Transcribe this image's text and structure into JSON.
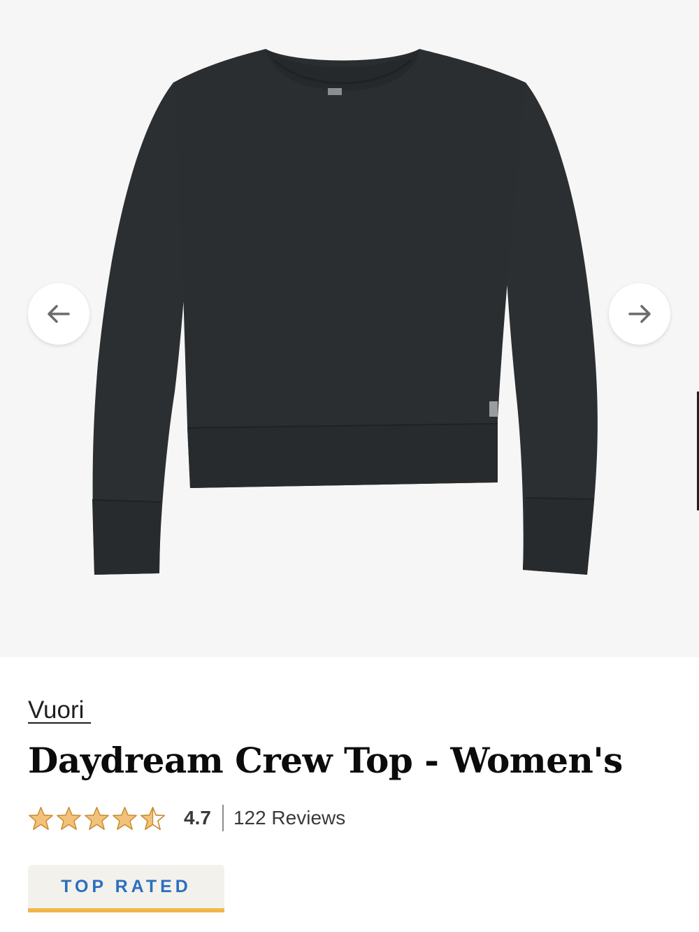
{
  "gallery": {
    "product_image_alt": "Daydream Crew Top - Women's",
    "prev_icon": "arrow-left-icon",
    "next_icon": "arrow-right-icon"
  },
  "product": {
    "brand": "Vuori ",
    "title": "Daydream Crew Top - Women's",
    "rating": {
      "stars_out_of_5": 4.5,
      "value": "4.7",
      "reviews": "122 Reviews"
    },
    "badge": "TOP RATED"
  },
  "colors": {
    "star": "#e0a84a",
    "badge_text": "#2a6fc0",
    "badge_underline": "#f1b64a",
    "garment": "#2b2e30"
  }
}
